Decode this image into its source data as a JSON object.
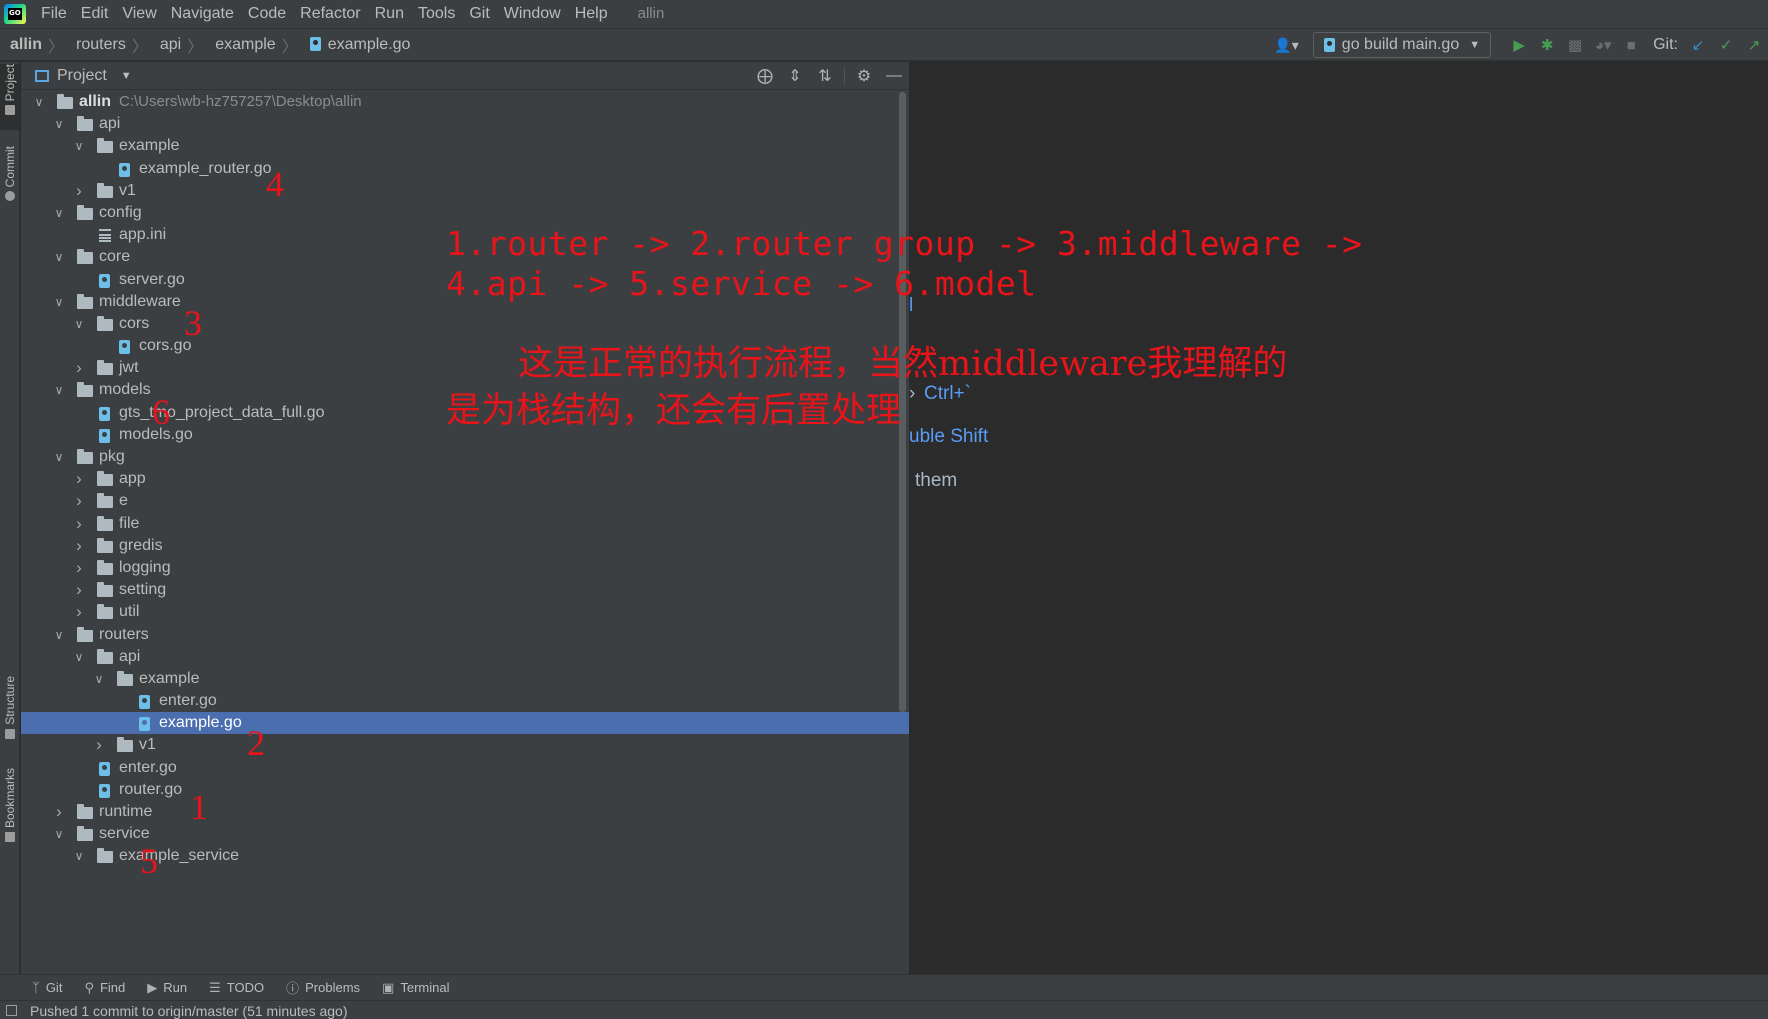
{
  "menubar": {
    "logo": "GO",
    "items": [
      "File",
      "Edit",
      "View",
      "Navigate",
      "Code",
      "Refactor",
      "Run",
      "Tools",
      "Git",
      "Window",
      "Help"
    ],
    "project_name": "allin"
  },
  "breadcrumb": [
    "allin",
    "routers",
    "api",
    "example",
    "example.go"
  ],
  "toolbar": {
    "run_config": "go build main.go",
    "git_label": "Git:"
  },
  "stripe": {
    "project": "Project",
    "commit": "Commit",
    "structure": "Structure",
    "bookmarks": "Bookmarks"
  },
  "project_panel": {
    "title": "Project",
    "tree": [
      {
        "name": "allin",
        "path": "C:\\Users\\wb-hz757257\\Desktop\\allin",
        "type": "folder",
        "depth": 0,
        "expanded": true,
        "root": true
      },
      {
        "name": "api",
        "type": "folder",
        "depth": 1,
        "expanded": true
      },
      {
        "name": "example",
        "type": "folder",
        "depth": 2,
        "expanded": true
      },
      {
        "name": "example_router.go",
        "type": "go",
        "depth": 3
      },
      {
        "name": "v1",
        "type": "folder",
        "depth": 2,
        "expanded": false
      },
      {
        "name": "config",
        "type": "folder",
        "depth": 1,
        "expanded": true
      },
      {
        "name": "app.ini",
        "type": "ini",
        "depth": 2
      },
      {
        "name": "core",
        "type": "folder",
        "depth": 1,
        "expanded": true
      },
      {
        "name": "server.go",
        "type": "go",
        "depth": 2
      },
      {
        "name": "middleware",
        "type": "folder",
        "depth": 1,
        "expanded": true
      },
      {
        "name": "cors",
        "type": "folder",
        "depth": 2,
        "expanded": true
      },
      {
        "name": "cors.go",
        "type": "go",
        "depth": 3
      },
      {
        "name": "jwt",
        "type": "folder",
        "depth": 2,
        "expanded": false
      },
      {
        "name": "models",
        "type": "folder",
        "depth": 1,
        "expanded": true
      },
      {
        "name": "gts_tmo_project_data_full.go",
        "type": "go",
        "depth": 2
      },
      {
        "name": "models.go",
        "type": "go",
        "depth": 2
      },
      {
        "name": "pkg",
        "type": "folder",
        "depth": 1,
        "expanded": true
      },
      {
        "name": "app",
        "type": "folder",
        "depth": 2,
        "expanded": false
      },
      {
        "name": "e",
        "type": "folder",
        "depth": 2,
        "expanded": false
      },
      {
        "name": "file",
        "type": "folder",
        "depth": 2,
        "expanded": false
      },
      {
        "name": "gredis",
        "type": "folder",
        "depth": 2,
        "expanded": false
      },
      {
        "name": "logging",
        "type": "folder",
        "depth": 2,
        "expanded": false
      },
      {
        "name": "setting",
        "type": "folder",
        "depth": 2,
        "expanded": false
      },
      {
        "name": "util",
        "type": "folder",
        "depth": 2,
        "expanded": false
      },
      {
        "name": "routers",
        "type": "folder",
        "depth": 1,
        "expanded": true
      },
      {
        "name": "api",
        "type": "folder",
        "depth": 2,
        "expanded": true
      },
      {
        "name": "example",
        "type": "folder",
        "depth": 3,
        "expanded": true
      },
      {
        "name": "enter.go",
        "type": "go",
        "depth": 4
      },
      {
        "name": "example.go",
        "type": "go",
        "depth": 4,
        "selected": true
      },
      {
        "name": "v1",
        "type": "folder",
        "depth": 3,
        "expanded": false
      },
      {
        "name": "enter.go",
        "type": "go",
        "depth": 2
      },
      {
        "name": "router.go",
        "type": "go",
        "depth": 2
      },
      {
        "name": "runtime",
        "type": "folder",
        "depth": 1,
        "expanded": false
      },
      {
        "name": "service",
        "type": "folder",
        "depth": 1,
        "expanded": true
      },
      {
        "name": "example_service",
        "type": "folder",
        "depth": 2,
        "expanded": true
      }
    ]
  },
  "editor_hints": {
    "hint1": "l",
    "hint2_prefix": "›",
    "hint2": "Ctrl+`",
    "hint3": "uble Shift",
    "hint4": "them"
  },
  "annotations": {
    "flow_line1": "1.router -> 2.router group -> 3.middleware ->",
    "flow_line2": "4.api -> 5.service -> 6.model",
    "note_line1": "这是正常的执行流程，当然middleware我理解的",
    "note_line2": "是为栈结构，还会有后置处理",
    "markers": [
      "4",
      "3",
      "6",
      "2",
      "1",
      "5"
    ],
    "color": "#e8141a"
  },
  "bottom_tools": [
    "Git",
    "Find",
    "Run",
    "TODO",
    "Problems",
    "Terminal"
  ],
  "status": "Pushed 1 commit to origin/master (51 minutes ago)",
  "colors": {
    "selection": "#4b6eaf",
    "panel_bg": "#3c3f41",
    "editor_bg": "#2b2b2b",
    "run_green": "#499c54",
    "git_blue": "#3592c4"
  }
}
